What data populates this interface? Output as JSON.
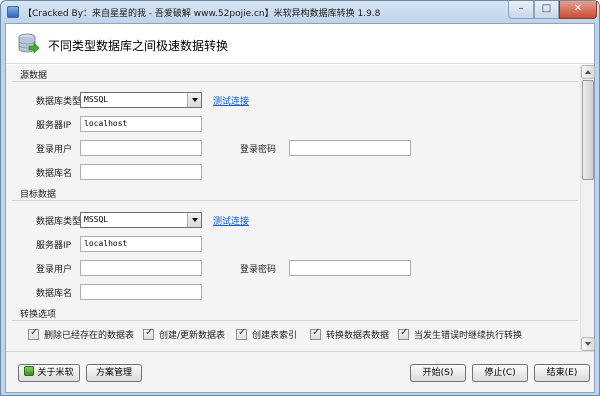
{
  "window": {
    "title": "【Cracked By：来自星星的我 - 吾爱破解 www.52pojie.cn】米软异构数据库转换 1.9.8",
    "min_glyph": "–",
    "max_glyph": "□",
    "close_glyph": "✕"
  },
  "header": {
    "title": "不同类型数据库之间极速数据转换",
    "icon": "database-convert-icon"
  },
  "source": {
    "section_title": "源数据",
    "db_type_label": "数据库类型",
    "db_type_value": "MSSQL",
    "test_link": "测试连接",
    "server_label": "服务器IP",
    "server_value": "localhost",
    "user_label": "登录用户",
    "user_value": "",
    "password_label": "登录密码",
    "password_value": "",
    "dbname_label": "数据库名",
    "dbname_value": ""
  },
  "target": {
    "section_title": "目标数据",
    "db_type_label": "数据库类型",
    "db_type_value": "MSSQL",
    "test_link": "测试连接",
    "server_label": "服务器IP",
    "server_value": "localhost",
    "user_label": "登录用户",
    "user_value": "",
    "password_label": "登录密码",
    "password_value": "",
    "dbname_label": "数据库名",
    "dbname_value": ""
  },
  "options": {
    "section_title": "转换选项",
    "items": [
      {
        "label": "删除已经存在的数据表",
        "checked": true
      },
      {
        "label": "创建/更新数据表",
        "checked": true
      },
      {
        "label": "创建表索引",
        "checked": true
      },
      {
        "label": "转换数据表数据",
        "checked": true
      },
      {
        "label": "当发生错误时继续执行转换",
        "checked": true
      }
    ]
  },
  "footer": {
    "about_label": "关于米软",
    "plan_label": "方案管理",
    "start_label": "开始(S)",
    "stop_label": "停止(C)",
    "end_label": "结束(E)"
  },
  "colors": {
    "link": "#0b5fd3",
    "close_button": "#c84a33",
    "titlebar": "#bed3e9"
  }
}
